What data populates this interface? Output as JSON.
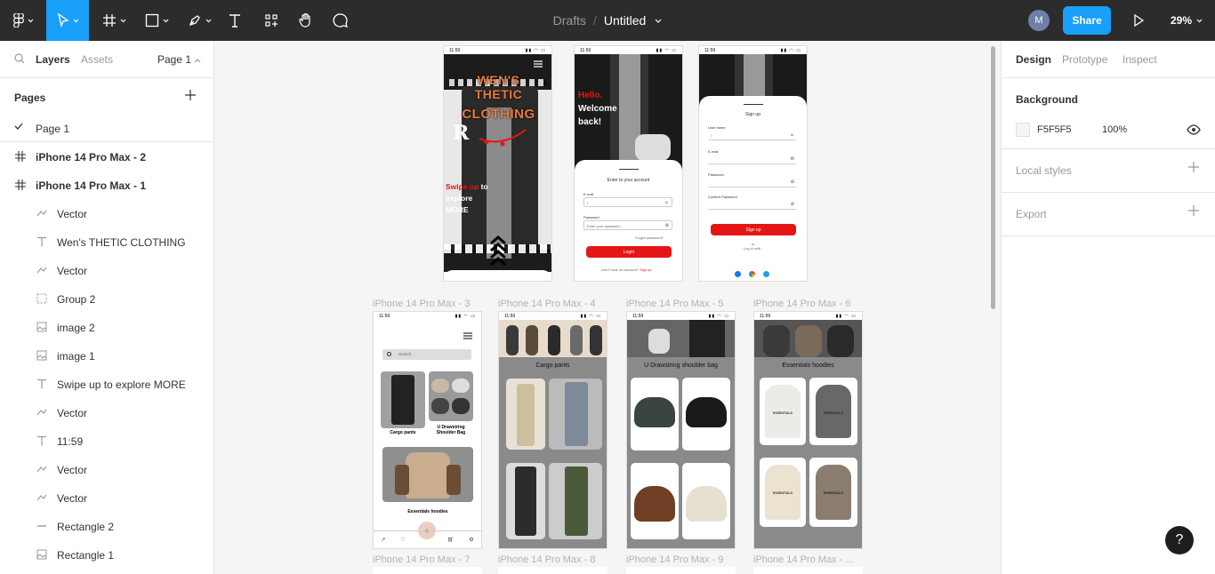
{
  "toolbar": {
    "breadcrumb_parent": "Drafts",
    "breadcrumb_sep": "/",
    "file_title": "Untitled",
    "avatar_initial": "M",
    "share_label": "Share",
    "zoom": "29%",
    "accent": "#18a0fb"
  },
  "left_panel": {
    "tab_layers": "Layers",
    "tab_assets": "Assets",
    "page_selector": "Page 1",
    "pages_heading": "Pages",
    "pages": [
      {
        "label": "Page 1",
        "selected": true
      }
    ],
    "layers": [
      {
        "label": "iPhone 14 Pro Max - 2",
        "icon": "frame-icon",
        "kind": "frame"
      },
      {
        "label": "iPhone 14 Pro Max - 1",
        "icon": "frame-icon",
        "kind": "frame"
      },
      {
        "label": "Vector",
        "icon": "vector-icon",
        "kind": "child"
      },
      {
        "label": "Wen's THETIC CLOTHING",
        "icon": "text-icon",
        "kind": "child"
      },
      {
        "label": "Vector",
        "icon": "vector-icon",
        "kind": "child"
      },
      {
        "label": "Group 2",
        "icon": "group-icon",
        "kind": "child"
      },
      {
        "label": "image 2",
        "icon": "image-icon",
        "kind": "child"
      },
      {
        "label": "image 1",
        "icon": "image-icon",
        "kind": "child"
      },
      {
        "label": "Swipe up to explore MORE",
        "icon": "text-icon",
        "kind": "child"
      },
      {
        "label": "Vector",
        "icon": "vector-icon",
        "kind": "child"
      },
      {
        "label": "11:59",
        "icon": "text-icon",
        "kind": "child"
      },
      {
        "label": "Vector",
        "icon": "vector-icon",
        "kind": "child"
      },
      {
        "label": "Vector",
        "icon": "vector-icon",
        "kind": "child"
      },
      {
        "label": "Rectangle 2",
        "icon": "line-icon",
        "kind": "child"
      },
      {
        "label": "Rectangle 1",
        "icon": "image-icon",
        "kind": "child"
      }
    ]
  },
  "canvas": {
    "frame_labels": {
      "f3": "iPhone 14 Pro Max - 3",
      "f4": "iPhone 14 Pro Max - 4",
      "f5": "iPhone 14 Pro Max - 5",
      "f6": "iPhone 14 Pro Max - 6",
      "f7": "iPhone 14 Pro Max - 7",
      "f8": "iPhone 14 Pro Max - 8",
      "f9": "iPhone 14 Pro Max - 9",
      "f10": "iPhone 14 Pro Max - ..."
    },
    "status_time": "11:59",
    "hero": {
      "title_line1": "WEN'S THETIC",
      "title_line2": "CLOTHING",
      "swipe_red": "Swipe up",
      "swipe_rest1": " to",
      "swipe_rest2": "explore",
      "swipe_rest3": "MORE"
    },
    "login": {
      "hello": "Hello.",
      "welcome1": "Welcome",
      "welcome2": "back!",
      "sheet_title": "Enter to your account",
      "email_label": "E-mail",
      "email_value": "I",
      "password_label": "Password",
      "password_placeholder": "Enter your password...",
      "forgot": "Forgot password?",
      "login_btn": "Login",
      "no_account": "Don't have an account?",
      "signup_link": "Sign up"
    },
    "signup": {
      "title": "Sign up",
      "username_label": "User name",
      "username_value": "I",
      "email_label": "E-mail",
      "password_label": "Password",
      "confirm_label": "Confirm Password",
      "btn": "Sign up",
      "or": "or",
      "login_with": "Log in with"
    },
    "home": {
      "search_placeholder": "Search",
      "cap_cargo": "Cargo pants",
      "cap_bag": "U Drawstring Shoulder Bag",
      "cap_hoodies": "Essentials hoodies"
    },
    "cargo_title": "Cargo pants",
    "bag_title": "U Drawstring shoulder bag",
    "hoodie_title": "Essentials hoodies",
    "hoodie_print": "ESSENTIALS",
    "brand_red": "#e61515"
  },
  "right_panel": {
    "tab_design": "Design",
    "tab_prototype": "Prototype",
    "tab_inspect": "Inspect",
    "background_heading": "Background",
    "background_hex": "F5F5F5",
    "background_opacity": "100%",
    "local_styles": "Local styles",
    "export": "Export"
  },
  "help_label": "?"
}
